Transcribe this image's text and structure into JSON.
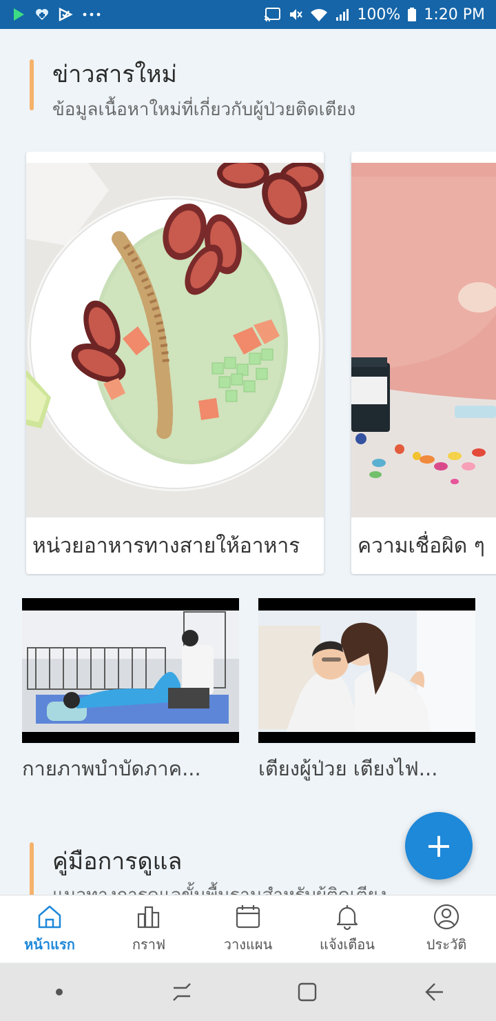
{
  "status_bar": {
    "battery": "100%",
    "time": "1:20 PM",
    "left_icons": [
      "play-store-icon",
      "heart-app-icon",
      "check-app-icon",
      "more-dots-icon"
    ],
    "right_icons": [
      "cast-icon",
      "mute-icon",
      "wifi-icon",
      "signal-icon",
      "battery-icon"
    ]
  },
  "news": {
    "title": "ข่าวสารใหม่",
    "subtitle": "ข้อมูลเนื้อหาใหม่ที่เกี่ยวกับผู้ป่วยติดเตียง",
    "cards": [
      {
        "caption": "หน่วยอาหารทางสายให้อาหาร",
        "image": "smoothie-bowl-with-figs"
      },
      {
        "caption": "ความเชื่อผิด ๆ",
        "image": "pills-and-medicine-bottle"
      }
    ]
  },
  "videos": [
    {
      "title": "กายภาพบำบัดภาค...",
      "image": "nurse-with-patient-on-bed"
    },
    {
      "title": "เตียงผู้ป่วย เตียงไฟ...",
      "image": "woman-with-elderly-mother-in-bed"
    }
  ],
  "guide": {
    "title": "คู่มือการดูแล",
    "subtitle": "แนวทางการดูแลขั้นพื้นฐานสำหรับผู้ติดเตียง"
  },
  "fab": {
    "label": "+"
  },
  "bottom_nav": {
    "items": [
      {
        "label": "หน้าแรก",
        "icon": "home-icon",
        "active": true
      },
      {
        "label": "กราฟ",
        "icon": "bar-chart-icon",
        "active": false
      },
      {
        "label": "วางแผน",
        "icon": "calendar-icon",
        "active": false
      },
      {
        "label": "แจ้งเตือน",
        "icon": "bell-icon",
        "active": false
      },
      {
        "label": "ประวัติ",
        "icon": "profile-icon",
        "active": false
      }
    ]
  },
  "colors": {
    "accent": "#1e88d9",
    "status_bar": "#1565a8",
    "section_marker": "#f6b26b",
    "background": "#eef4f8"
  }
}
